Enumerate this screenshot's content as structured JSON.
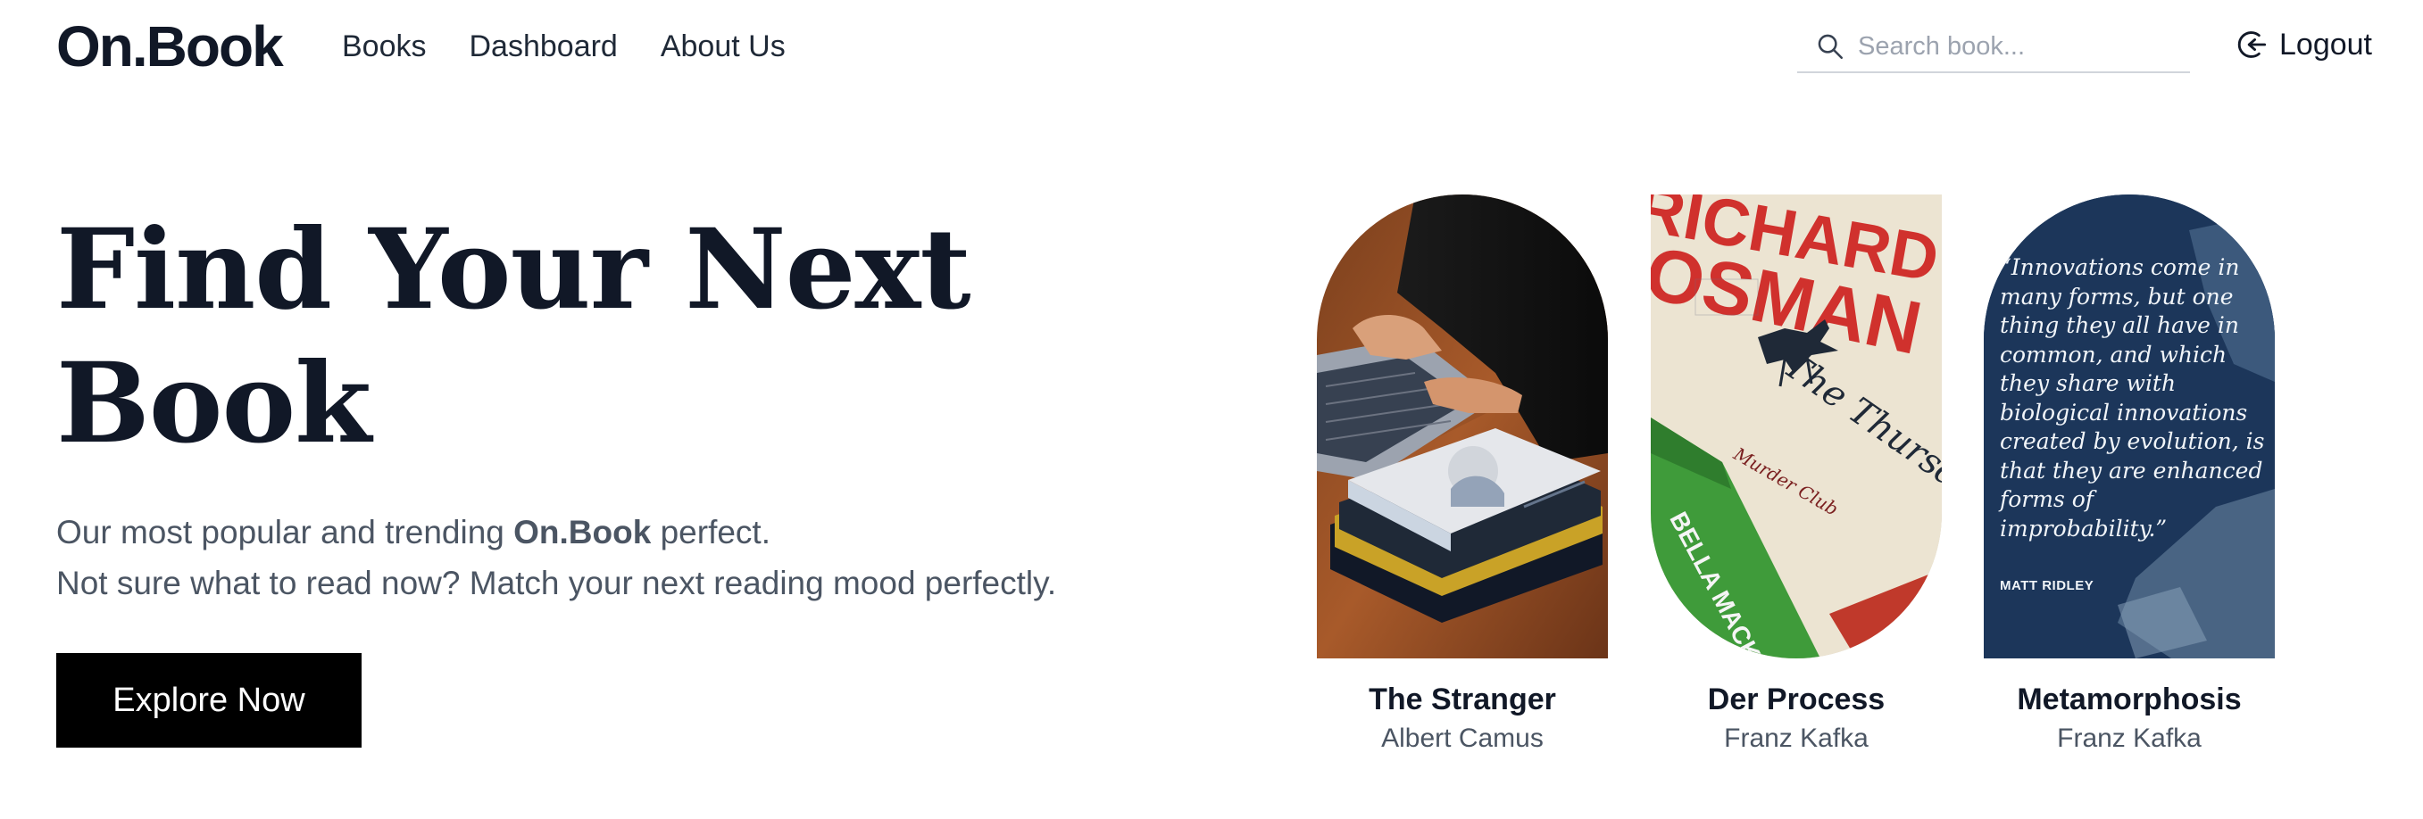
{
  "brand": {
    "logo": "On.Book"
  },
  "nav": {
    "links": [
      "Books",
      "Dashboard",
      "About Us"
    ],
    "search_placeholder": "Search book...",
    "logout_label": "Logout"
  },
  "hero": {
    "title_line1": "Find Your Next",
    "title_line2": "Book",
    "subtitle_pre": "Our most popular and trending ",
    "subtitle_brand": "On.Book",
    "subtitle_post": " perfect.",
    "subtitle_line2": "Not sure what to read now? Match your next reading mood perfectly.",
    "cta_label": "Explore Now"
  },
  "books": [
    {
      "title": "The Stranger",
      "author": "Albert Camus"
    },
    {
      "title": "Der Process",
      "author": "Franz Kafka"
    },
    {
      "title": "Metamorphosis",
      "author": "Franz Kafka",
      "cover_quote": "“Innovations come in many forms, but one thing they all have in common, and which they share with biological innovations created by evolution, is that they are enhanced forms of improbability.”",
      "cover_quote_author": "MATT RIDLEY"
    }
  ],
  "cover_texts": {
    "osman_top": "RICHARD",
    "osman_name": "OSMAN",
    "osman_book": "The Thursday MUR",
    "osman_side": "BELLA MACKIE",
    "osman_club": "Murder Club"
  },
  "colors": {
    "text_dark": "#111827",
    "text_muted": "#4b5563",
    "cta_bg": "#000000",
    "quote_cover_bg": "#1e3a5f"
  }
}
